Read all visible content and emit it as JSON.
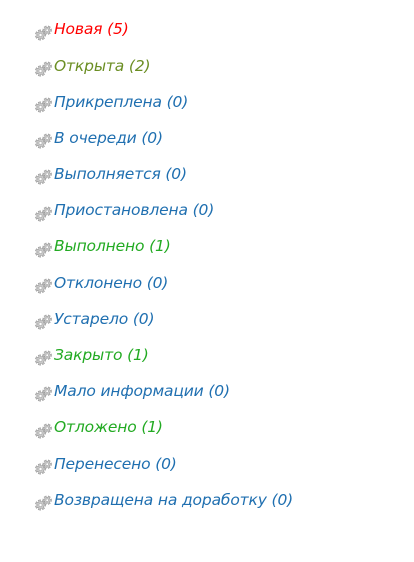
{
  "colors": {
    "new": "#ff0000",
    "open": "#6b8e23",
    "blue": "#1f6fb0",
    "green": "#22aa22"
  },
  "statuses": [
    {
      "label": "Новая (5)",
      "color": "#ff0000",
      "icon": "gear-icon"
    },
    {
      "label": "Открыта (2)",
      "color": "#6b8e23",
      "icon": "gear-icon"
    },
    {
      "label": "Прикреплена (0)",
      "color": "#1f6fb0",
      "icon": "gear-icon"
    },
    {
      "label": "В очереди (0)",
      "color": "#1f6fb0",
      "icon": "gear-icon"
    },
    {
      "label": "Выполняется (0)",
      "color": "#1f6fb0",
      "icon": "gear-icon"
    },
    {
      "label": "Приостановлена (0)",
      "color": "#1f6fb0",
      "icon": "gear-icon"
    },
    {
      "label": "Выполнено (1)",
      "color": "#22aa22",
      "icon": "gear-icon"
    },
    {
      "label": "Отклонено (0)",
      "color": "#1f6fb0",
      "icon": "gear-icon"
    },
    {
      "label": "Устарело (0)",
      "color": "#1f6fb0",
      "icon": "gear-icon"
    },
    {
      "label": "Закрыто (1)",
      "color": "#22aa22",
      "icon": "gear-icon"
    },
    {
      "label": "Мало информации (0)",
      "color": "#1f6fb0",
      "icon": "gear-icon"
    },
    {
      "label": "Отложено (1)",
      "color": "#22aa22",
      "icon": "gear-icon"
    },
    {
      "label": "Перенесено (0)",
      "color": "#1f6fb0",
      "icon": "gear-icon"
    },
    {
      "label": "Возвращена на доработку (0)",
      "color": "#1f6fb0",
      "icon": "gear-icon"
    }
  ]
}
